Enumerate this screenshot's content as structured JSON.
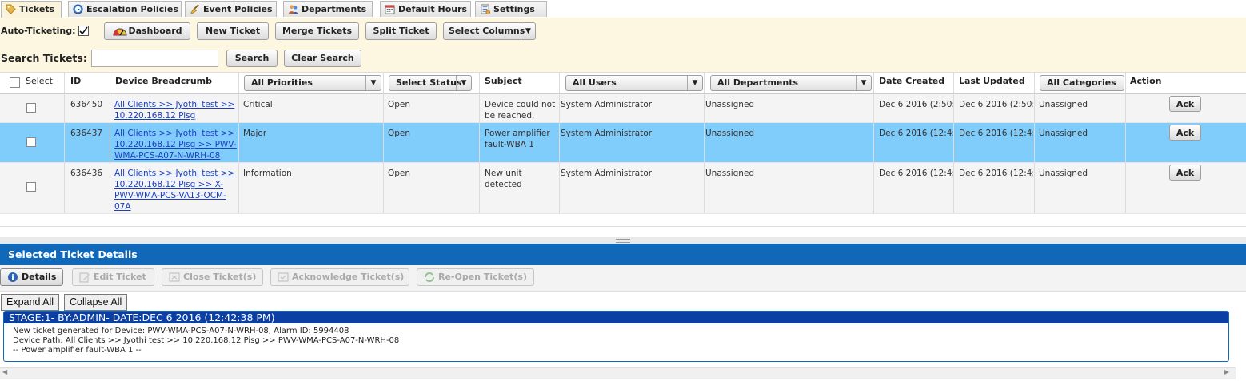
{
  "tabs": [
    {
      "label": "Tickets",
      "icon": "tag-icon",
      "active": true
    },
    {
      "label": "Escalation Policies",
      "icon": "clock-icon"
    },
    {
      "label": "Event Policies",
      "icon": "broom-icon"
    },
    {
      "label": "Departments",
      "icon": "people-icon"
    },
    {
      "label": "Default Hours",
      "icon": "calendar-icon"
    },
    {
      "label": "Settings",
      "icon": "settings-icon"
    }
  ],
  "toolbar": {
    "auto_ticketing_label": "Auto-Ticketing:",
    "dashboard": "Dashboard",
    "new_ticket": "New Ticket",
    "merge_tickets": "Merge Tickets",
    "split_ticket": "Split Ticket",
    "select_columns": "Select Columns",
    "search_label": "Search Tickets:",
    "search_value": "",
    "search": "Search",
    "clear_search": "Clear Search"
  },
  "grid": {
    "headers": {
      "select": "Select",
      "id": "ID",
      "breadcrumb": "Device Breadcrumb",
      "priorities": "All Priorities",
      "status": "Select Status",
      "subject": "Subject",
      "users": "All Users",
      "departments": "All Departments",
      "date_created": "Date Created",
      "last_updated": "Last Updated",
      "categories": "All Categories",
      "action": "Action"
    },
    "rows": [
      {
        "id": "636450",
        "breadcrumb": "All Clients >> Jyothi test >> 10.220.168.12 Pisg",
        "priority": "Critical",
        "status": "Open",
        "subject": "Device could not be reached.",
        "user": "System Administrator",
        "department": "Unassigned",
        "created": "Dec 6 2016 (2:50:",
        "updated": "Dec 6 2016 (2:50:",
        "category": "Unassigned",
        "action": "Ack",
        "selected": false
      },
      {
        "id": "636437",
        "breadcrumb": "All Clients >> Jyothi test >> 10.220.168.12 Pisg >> PWV-WMA-PCS-A07-N-WRH-08",
        "priority": "Major",
        "status": "Open",
        "subject": "Power amplifier fault-WBA 1",
        "user": "System Administrator",
        "department": "Unassigned",
        "created": "Dec 6 2016 (12:4:",
        "updated": "Dec 6 2016 (12:4:",
        "category": "Unassigned",
        "action": "Ack",
        "selected": true
      },
      {
        "id": "636436",
        "breadcrumb": "All Clients >> Jyothi test >> 10.220.168.12 Pisg >> X-PWV-WMA-PCS-VA13-OCM-07A",
        "priority": "Information",
        "status": "Open",
        "subject": "New unit detected",
        "user": "System Administrator",
        "department": "Unassigned",
        "created": "Dec 6 2016 (12:4:",
        "updated": "Dec 6 2016 (12:4:",
        "category": "Unassigned",
        "action": "Ack",
        "selected": false
      }
    ]
  },
  "details": {
    "title": "Selected Ticket Details",
    "buttons": {
      "details": "Details",
      "edit": "Edit Ticket",
      "close": "Close Ticket(s)",
      "ack": "Acknowledge Ticket(s)",
      "reopen": "Re-Open Ticket(s)"
    },
    "expand_all": "Expand All",
    "collapse_all": "Collapse All",
    "stage_header": "STAGE:1- BY:ADMIN- DATE:DEC 6 2016 (12:42:38 PM)",
    "lines": [
      "New ticket generated for Device: PWV-WMA-PCS-A07-N-WRH-08, Alarm ID: 5994408",
      "Device Path: All Clients >> Jyothi test >> 10.220.168.12 Pisg >> PWV-WMA-PCS-A07-N-WRH-08",
      "-- Power amplifier fault-WBA 1 --"
    ]
  },
  "colors": {
    "accent": "#1167b8",
    "selected_row": "#80ccfb",
    "toolbar_bg": "#fdf6e0"
  }
}
